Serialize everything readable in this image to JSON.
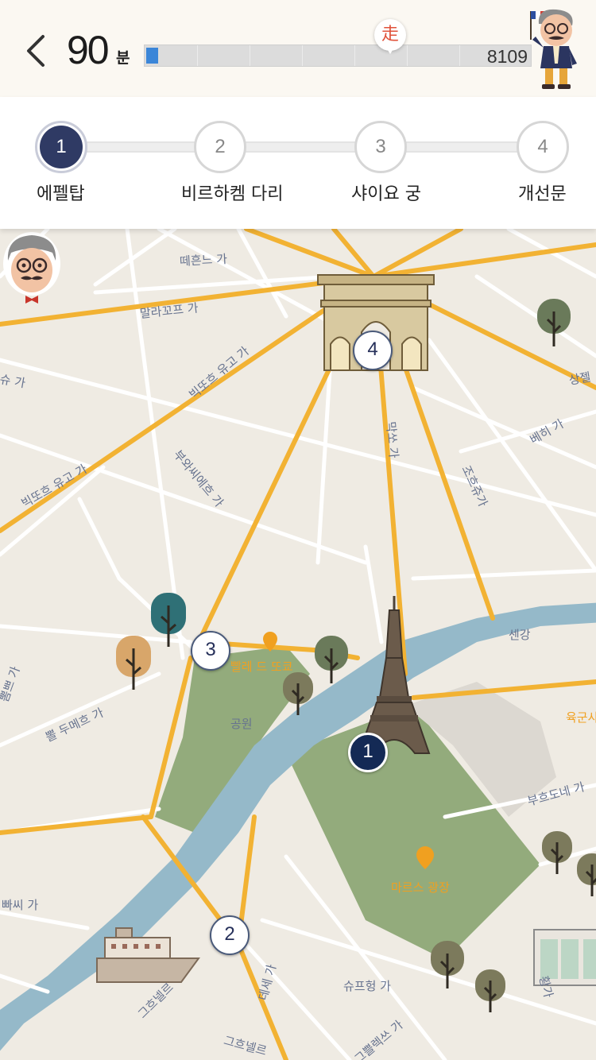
{
  "header": {
    "back_icon": "chevron-left-icon",
    "time_value": "90",
    "time_unit": "분",
    "progress_total": "8109",
    "progress_fraction": 0.03,
    "walk_marker": "走",
    "colors": {
      "progress_fill": "#3b86d8",
      "walk_marker": "#e0523a"
    }
  },
  "steps": [
    {
      "number": "1",
      "label": "에펠탑",
      "active": true
    },
    {
      "number": "2",
      "label": "비르하켐 다리",
      "active": false
    },
    {
      "number": "3",
      "label": "샤이요 궁",
      "active": false
    },
    {
      "number": "4",
      "label": "개선문",
      "active": false
    }
  ],
  "map": {
    "pins": [
      "1",
      "2",
      "3",
      "4"
    ],
    "labels": {
      "rue_1": "떼흔느 가",
      "rue_2": "말라꼬프 가",
      "rue_3": "빅또흐 유고 가",
      "rue_4": "빅또흐 유고 가",
      "rue_5": "부와씨에흐 가",
      "rue_6": "막쏘 가",
      "rue_7": "조흐쥬가",
      "rue_8": "베히 가",
      "rue_9": "상젤",
      "rue_10": "슈 가",
      "rue_11": "뽐쁘 가",
      "rue_12": "뽈 두메흐 가",
      "rue_13": "빠씨 가",
      "rue_14": "센강",
      "rue_15": "공원",
      "rue_16": "부흐도네 가",
      "rue_17": "슈프헝 가",
      "rue_18": "데세 가",
      "rue_19": "그흐넬르",
      "rue_20": "그흐넬르",
      "rue_21": "그쁠렉쓰 가",
      "rue_22": "황가",
      "poi_1": "빨레 드 또쿄",
      "poi_2": "마르스 광장",
      "poi_3": "육군사"
    },
    "colors": {
      "land": "#efebe3",
      "river": "#95b9c9",
      "park": "#93ab7c",
      "major_road": "#f2b233",
      "minor_road": "#ffffff"
    }
  }
}
